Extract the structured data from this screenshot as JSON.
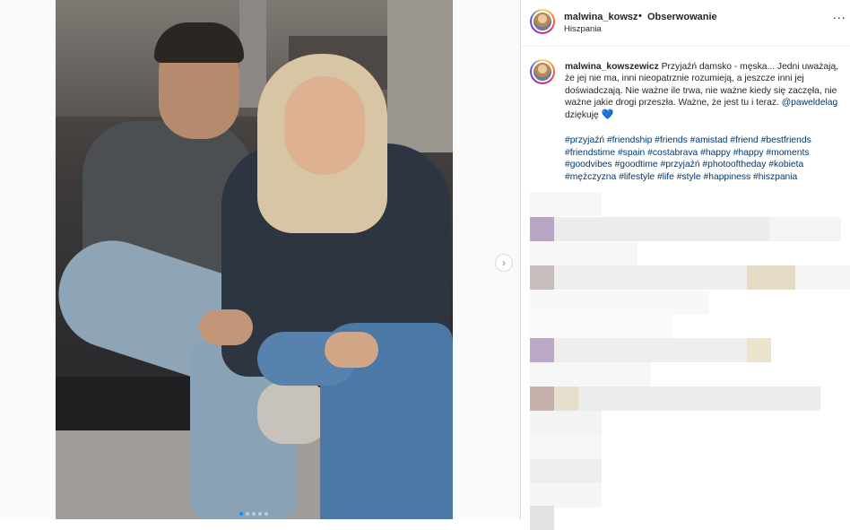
{
  "post": {
    "username": "malwina_kowszewicz",
    "username_short": "malwina_kowszev",
    "separator": "•",
    "follow_label": "Obserwowanie",
    "location": "Hiszpania",
    "more_label": "...",
    "next_icon": "chevron-right-icon",
    "carousel_total": 5,
    "carousel_active": 1
  },
  "caption": {
    "username": "malwina_kowszewicz",
    "text": " Przyjaźń damsko - męska... Jedni uważają, że jej nie ma, inni nieopatrznie rozumieją, a jeszcze inni jej doświadczają. Nie ważne ile trwa, nie ważne kiedy się zaczęła, nie ważne jakie drogi przeszła. Ważne, że jest tu i teraz. ",
    "mention": "@paweldelag",
    "text_end": " dziękuję ",
    "heart": "💙",
    "hashtags": "#przyjaźń #friendship #friends #amistad #friend #bestfriends #friendstime #spain #costabrava #happy #happy #moments #goodvibes #goodtime #przyjaźń #photooftheday #kobieta #mężczyzna #lifestyle #life #style #happiness #hiszpania"
  },
  "colors": {
    "link": "#00376b",
    "heart": "#3897f0",
    "border": "#dbdbdb"
  }
}
